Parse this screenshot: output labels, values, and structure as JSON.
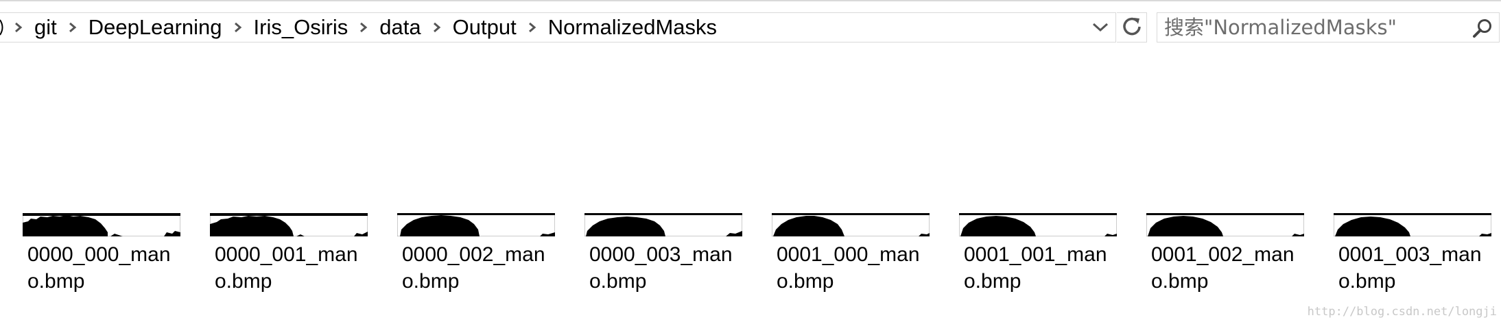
{
  "address_bar": {
    "breadcrumbs": [
      "git",
      "DeepLearning",
      "Iris_Osiris",
      "data",
      "Output",
      "NormalizedMasks"
    ]
  },
  "search": {
    "placeholder": "搜索\"NormalizedMasks\""
  },
  "files": [
    {
      "name": "0000_000_mano.bmp"
    },
    {
      "name": "0000_001_mano.bmp"
    },
    {
      "name": "0000_002_mano.bmp"
    },
    {
      "name": "0000_003_mano.bmp"
    },
    {
      "name": "0001_000_mano.bmp"
    },
    {
      "name": "0001_001_mano.bmp"
    },
    {
      "name": "0001_002_mano.bmp"
    },
    {
      "name": "0001_003_mano.bmp"
    }
  ],
  "watermark": "http://blog.csdn.net/longji",
  "icons": {
    "separator": "chevron-right-icon",
    "dropdown": "chevron-down-icon",
    "refresh": "refresh-icon",
    "search": "search-icon"
  },
  "colors": {
    "border": "#d9d9d9",
    "icon": "#555555",
    "placeholder": "#6d6d6d",
    "watermark": "#c8c8c8"
  }
}
